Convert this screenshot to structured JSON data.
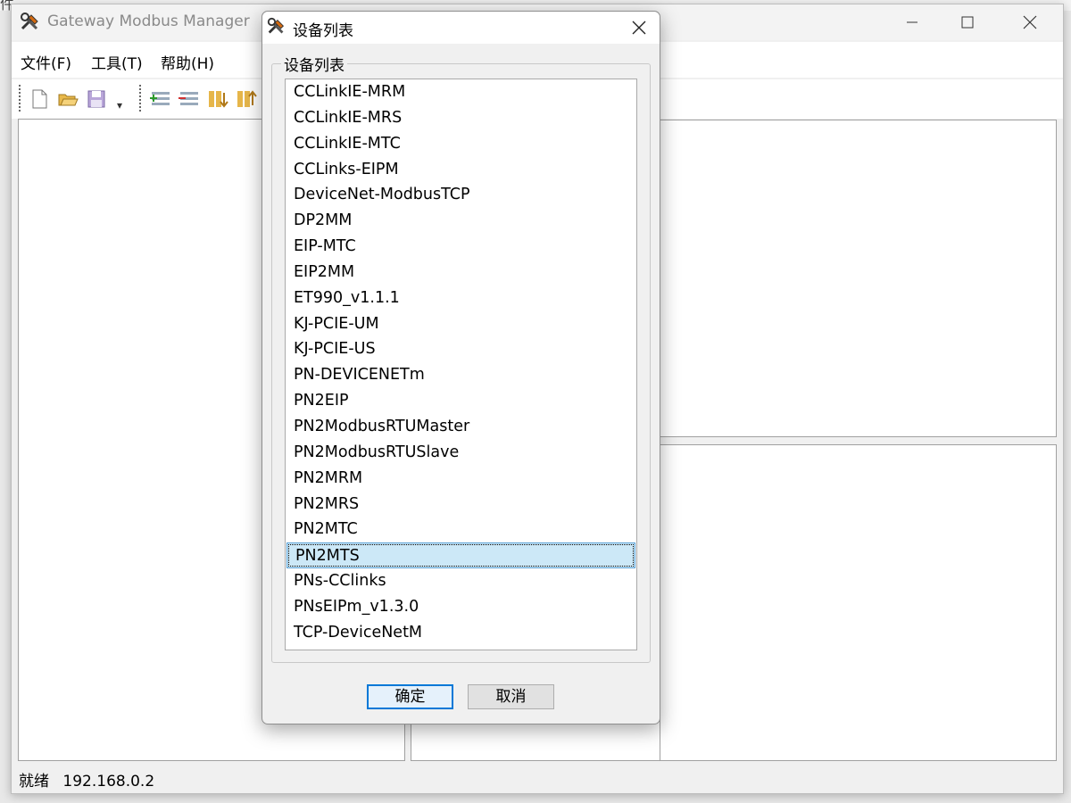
{
  "main_window": {
    "title": "Gateway Modbus Manager",
    "menu": [
      "文件(F)",
      "工具(T)",
      "帮助(H)"
    ],
    "status": {
      "text": "就绪",
      "ip": "192.168.0.2"
    }
  },
  "dialog": {
    "title": "设备列表",
    "group_label": "设备列表",
    "items": [
      "CCLinkIE-MRM",
      "CCLinkIE-MRS",
      "CCLinkIE-MTC",
      "CCLinks-EIPM",
      "DeviceNet-ModbusTCP",
      "DP2MM",
      "EIP-MTC",
      "EIP2MM",
      "ET990_v1.1.1",
      "KJ-PCIE-UM",
      "KJ-PCIE-US",
      "PN-DEVICENETm",
      "PN2EIP",
      "PN2ModbusRTUMaster",
      "PN2ModbusRTUSlave",
      "PN2MRM",
      "PN2MRS",
      "PN2MTC",
      "PN2MTS",
      "PNs-CClinks",
      "PNsEIPm_v1.3.0",
      "TCP-DeviceNetM"
    ],
    "selected": "PN2MTS",
    "ok_label": "确定",
    "cancel_label": "取消"
  },
  "colors": {
    "selection": "#cce8f7",
    "default_button_border": "#0078d7"
  },
  "icons": [
    "tools-icon",
    "new-file-icon",
    "open-folder-icon",
    "save-icon",
    "minimize-icon",
    "maximize-icon",
    "close-icon"
  ]
}
